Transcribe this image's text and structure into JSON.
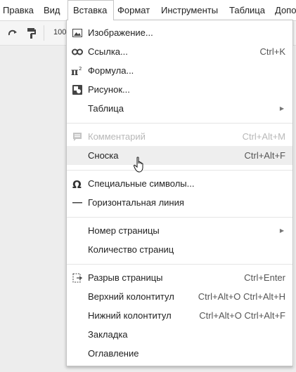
{
  "menubar": {
    "items": [
      {
        "label": "Правка"
      },
      {
        "label": "Вид"
      },
      {
        "label": "Вставка"
      },
      {
        "label": "Формат"
      },
      {
        "label": "Инструменты"
      },
      {
        "label": "Таблица"
      },
      {
        "label": "Допо"
      }
    ]
  },
  "toolbar": {
    "zoom": "100",
    "icons": [
      "redo-icon",
      "paint-format-icon"
    ]
  },
  "menu": {
    "items": [
      {
        "label": "Изображение...",
        "shortcut": "",
        "icon": "image-icon"
      },
      {
        "label": "Ссылка...",
        "shortcut": "Ctrl+K",
        "icon": "link-icon"
      },
      {
        "label": "Формула...",
        "shortcut": "",
        "icon": "equation-icon"
      },
      {
        "label": "Рисунок...",
        "shortcut": "",
        "icon": "drawing-icon"
      },
      {
        "label": "Таблица",
        "shortcut": "",
        "icon": "",
        "submenu": true
      },
      {
        "label": "Комментарий",
        "shortcut": "Ctrl+Alt+M",
        "icon": "comment-icon",
        "disabled": true
      },
      {
        "label": "Сноска",
        "shortcut": "Ctrl+Alt+F",
        "icon": "",
        "hover": true
      },
      {
        "label": "Специальные символы...",
        "shortcut": "",
        "icon": "omega-icon"
      },
      {
        "label": "Горизонтальная линия",
        "shortcut": "",
        "icon": "horizontal-line-icon"
      },
      {
        "label": "Номер страницы",
        "shortcut": "",
        "icon": "",
        "submenu": true
      },
      {
        "label": "Количество страниц",
        "shortcut": "",
        "icon": ""
      },
      {
        "label": "Разрыв страницы",
        "shortcut": "Ctrl+Enter",
        "icon": "page-break-icon"
      },
      {
        "label": "Верхний колонтитул",
        "shortcut": "Ctrl+Alt+O Ctrl+Alt+H",
        "icon": ""
      },
      {
        "label": "Нижний колонтитул",
        "shortcut": "Ctrl+Alt+O Ctrl+Alt+F",
        "icon": ""
      },
      {
        "label": "Закладка",
        "shortcut": "",
        "icon": ""
      },
      {
        "label": "Оглавление",
        "shortcut": "",
        "icon": ""
      }
    ]
  },
  "colors": {
    "hover": "#eeeeee",
    "disabled_text": "#b8b8b8",
    "border": "#c6c6c6"
  }
}
